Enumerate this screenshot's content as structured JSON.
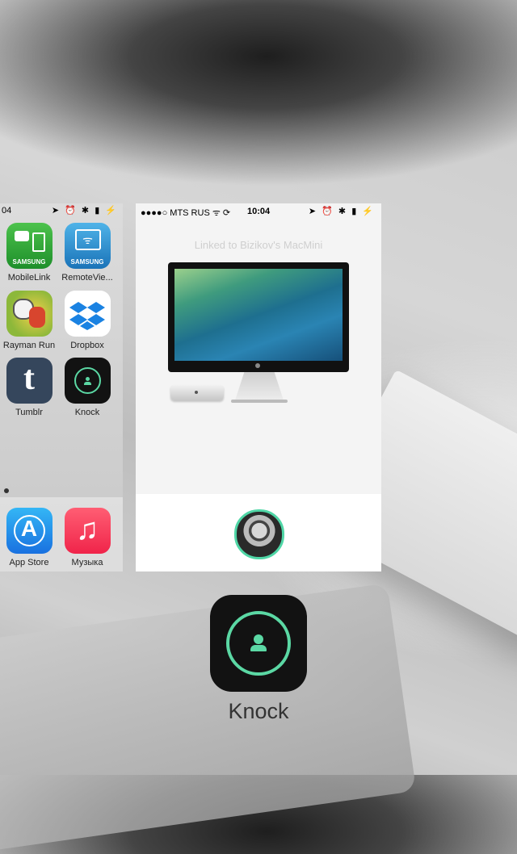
{
  "springboard": {
    "status_time": "04",
    "status_icons": "➤ ⏰ ✱ ▮ ⚡",
    "apps": [
      {
        "label": "MobileLink",
        "icon": "samsung-mobilelink-icon",
        "badge": "SAMSUNG"
      },
      {
        "label": "RemoteVie...",
        "icon": "samsung-remoteview-icon",
        "badge": "SAMSUNG"
      },
      {
        "label": "Rayman Run",
        "icon": "rayman-icon"
      },
      {
        "label": "Dropbox",
        "icon": "dropbox-icon"
      },
      {
        "label": "Tumblr",
        "icon": "tumblr-icon",
        "glyph": "t"
      },
      {
        "label": "Knock",
        "icon": "knock-icon"
      }
    ],
    "dock": [
      {
        "label": "App Store",
        "icon": "app-store-icon"
      },
      {
        "label": "Музыка",
        "icon": "music-icon",
        "glyph": "♫"
      }
    ]
  },
  "knock_app": {
    "status_carrier": "●●●●○ MTS RUS ᯤ ⟳",
    "status_time": "10:04",
    "status_icons": "➤ ⏰ ✱ ▮ ⚡",
    "linked_text": "Linked to Bizikov's MacMini"
  },
  "app_switcher": {
    "app_name": "Knock"
  },
  "colors": {
    "accent": "#5bd8a4"
  }
}
